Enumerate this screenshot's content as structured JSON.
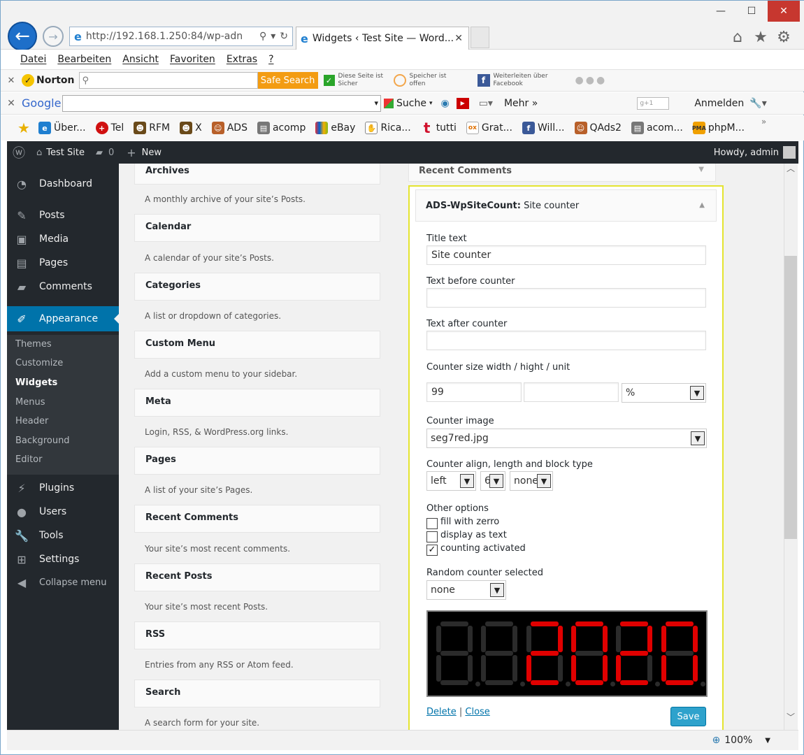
{
  "browser": {
    "url": "http://192.168.1.250:84/wp-adn",
    "tab_title": "Widgets ‹ Test Site — Word...",
    "menu": [
      "Datei",
      "Bearbeiten",
      "Ansicht",
      "Favoriten",
      "Extras",
      "?"
    ],
    "zoom": "100%"
  },
  "norton": {
    "brand": "Norton",
    "search_button": "Safe Search",
    "status1_line1": "Diese Seite ist",
    "status1_line2": "Sicher",
    "status2_line1": "Speicher ist",
    "status2_line2": "offen",
    "status3_line1": "Weiterleiten über",
    "status3_line2": "Facebook"
  },
  "googlebar": {
    "brand": "Google",
    "search": "Suche",
    "more": "Mehr",
    "signin": "Anmelden"
  },
  "favorites": [
    "Über...",
    "Tel",
    "RFM",
    "X",
    "ADS",
    "acomp",
    "eBay",
    "Rica...",
    "tutti",
    "Grat...",
    "Will...",
    "QAds2",
    "acom...",
    "phpM..."
  ],
  "adminbar": {
    "site": "Test Site",
    "comments": "0",
    "new": "New",
    "howdy": "Howdy, admin"
  },
  "sidebar": {
    "items": [
      "Dashboard",
      "Posts",
      "Media",
      "Pages",
      "Comments",
      "Appearance",
      "Plugins",
      "Users",
      "Tools",
      "Settings",
      "Collapse menu"
    ],
    "submenu": [
      "Themes",
      "Customize",
      "Widgets",
      "Menus",
      "Header",
      "Background",
      "Editor"
    ]
  },
  "widgets": [
    {
      "title": "Archives",
      "desc": "A monthly archive of your site’s Posts."
    },
    {
      "title": "Calendar",
      "desc": "A calendar of your site’s Posts."
    },
    {
      "title": "Categories",
      "desc": "A list or dropdown of categories."
    },
    {
      "title": "Custom Menu",
      "desc": "Add a custom menu to your sidebar."
    },
    {
      "title": "Meta",
      "desc": "Login, RSS, & WordPress.org links."
    },
    {
      "title": "Pages",
      "desc": "A list of your site’s Pages."
    },
    {
      "title": "Recent Comments",
      "desc": "Your site’s most recent comments."
    },
    {
      "title": "Recent Posts",
      "desc": "Your site’s most recent Posts."
    },
    {
      "title": "RSS",
      "desc": "Entries from any RSS or Atom feed."
    },
    {
      "title": "Search",
      "desc": "A search form for your site."
    }
  ],
  "sidebar_widget": {
    "recent_comments": "Recent Comments",
    "header_bold": "ADS-WpSiteCount:",
    "header_name": "Site counter",
    "title_label": "Title text",
    "title_value": "Site counter",
    "before_label": "Text before counter",
    "before_value": "",
    "after_label": "Text after counter",
    "after_value": "",
    "size_label": "Counter size width / hight / unit",
    "size_width": "99",
    "size_height": "",
    "size_unit": "%",
    "image_label": "Counter image",
    "image_value": "seg7red.jpg",
    "align_label": "Counter align, length and block type",
    "align_value": "left",
    "length_value": "6",
    "block_value": "none",
    "other_label": "Other options",
    "opt_fill": "fill with zerro",
    "opt_fill_checked": false,
    "opt_text": "display as text",
    "opt_text_checked": false,
    "opt_count": "counting activated",
    "opt_count_checked": true,
    "random_label": "Random counter selected",
    "random_value": "none",
    "counter_digits": [
      "8",
      "8",
      "2",
      "0",
      "2",
      "0"
    ],
    "counter_lit": [
      false,
      false,
      true,
      true,
      true,
      true
    ],
    "delete": "Delete",
    "sep": "|",
    "close": "Close",
    "save": "Save"
  },
  "colors": {
    "wp_dark": "#23282d",
    "wp_blue": "#0073aa",
    "seg_on": "#e00000",
    "seg_off": "#2b2b2b"
  }
}
